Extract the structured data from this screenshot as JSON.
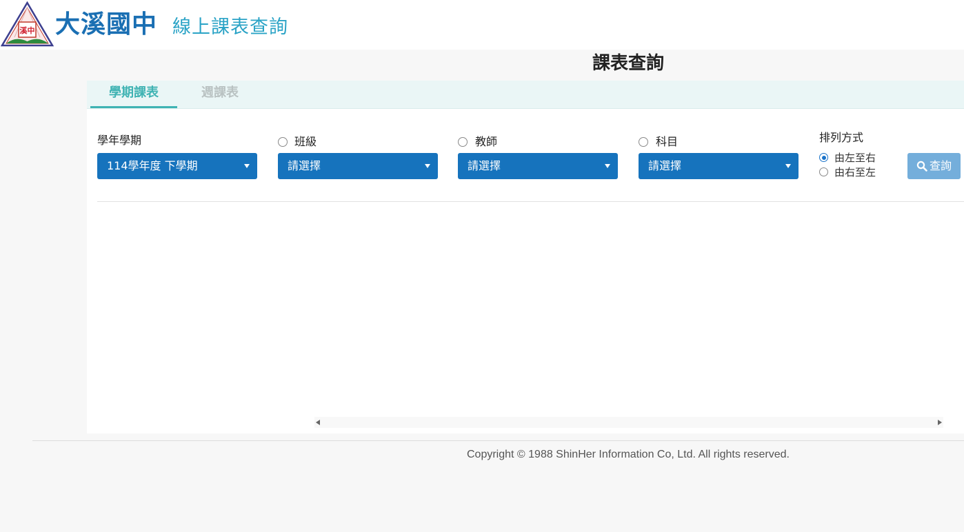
{
  "header": {
    "school_name": "大溪國中",
    "app_name": "線上課表查詢",
    "logo_text": "溪中"
  },
  "page": {
    "title": "課表查詢"
  },
  "tabs": [
    {
      "label": "學期課表",
      "active": true
    },
    {
      "label": "週課表",
      "active": false
    }
  ],
  "filters": {
    "semester": {
      "label": "學年學期",
      "value": "114學年度 下學期"
    },
    "class": {
      "label": "班級",
      "value": "請選擇",
      "checked": false
    },
    "teacher": {
      "label": "教師",
      "value": "請選擇",
      "checked": false
    },
    "subject": {
      "label": "科目",
      "value": "請選擇",
      "checked": false
    }
  },
  "sort": {
    "label": "排列方式",
    "options": [
      {
        "label": "由左至右",
        "checked": true
      },
      {
        "label": "由右至左",
        "checked": false
      }
    ]
  },
  "query_button": {
    "label": "查詢",
    "icon": "search-icon"
  },
  "footer": {
    "copyright": "Copyright © 1988 ShinHer Information Co, Ltd. All rights reserved."
  },
  "colors": {
    "primary": "#1673bd",
    "accent": "#3fb3b3",
    "title_blue": "#1a6fb3",
    "app_name": "#2aa3c6"
  }
}
